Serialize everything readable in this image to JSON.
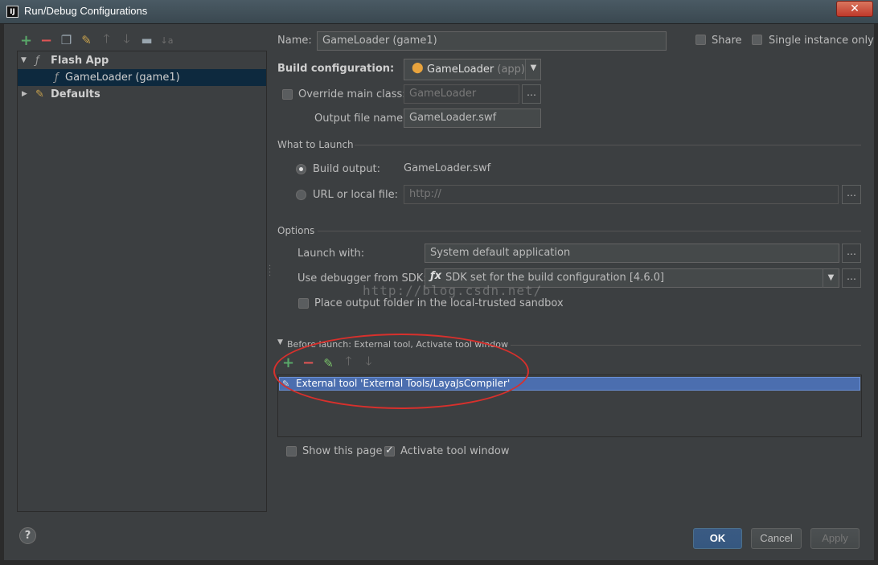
{
  "window": {
    "title": "Run/Debug Configurations",
    "app_icon": "IJ",
    "close_label": "✕"
  },
  "toolbar": {
    "icons": [
      "add-icon",
      "remove-icon",
      "copy-icon",
      "edit-defaults-icon",
      "move-up-icon",
      "move-down-icon",
      "folder-icon",
      "sort-icon"
    ]
  },
  "tree": {
    "items": [
      {
        "label": "Flash App",
        "expanded": true
      },
      {
        "label": "GameLoader (game1)",
        "selected": true
      },
      {
        "label": "Defaults",
        "expanded": false
      }
    ]
  },
  "form": {
    "name_label": "Name:",
    "name_value": "GameLoader (game1)",
    "share_label": "Share",
    "single_instance_label": "Single instance only",
    "build_config_label": "Build configuration:",
    "build_config_value": "GameLoader",
    "build_config_suffix": "(app)",
    "override_main_label": "Override main class:",
    "override_main_value": "GameLoader",
    "output_file_label": "Output file name:",
    "output_file_value": "GameLoader.swf"
  },
  "what_to_launch": {
    "section": "What to Launch",
    "build_output_label": "Build output:",
    "build_output_value": "GameLoader.swf",
    "url_label": "URL or local file:",
    "url_value": "http://"
  },
  "options": {
    "section": "Options",
    "launch_with_label": "Launch with:",
    "launch_with_value": "System default application",
    "debugger_label": "Use debugger from SDK:",
    "debugger_value": "SDK set for the build configuration [4.6.0]",
    "place_output_label": "Place output folder in the local-trusted sandbox"
  },
  "before_launch": {
    "section": "Before launch: External tool, Activate tool window",
    "items": [
      "External tool 'External Tools/LayaJsCompiler'"
    ],
    "show_page_label": "Show this page",
    "activate_label": "Activate tool window"
  },
  "watermark": "http://blog.csdn.net/",
  "buttons": {
    "ok": "OK",
    "cancel": "Cancel",
    "apply": "Apply",
    "help": "?"
  },
  "colors": {
    "accent": "#4b6eaf",
    "selection": "#0d293e",
    "annotation": "#d8302c",
    "background": "#3c3f41"
  }
}
